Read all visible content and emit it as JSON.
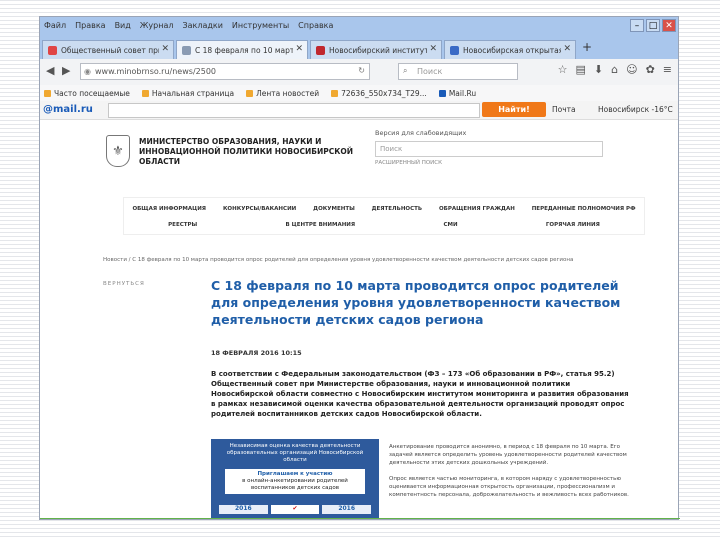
{
  "browser": {
    "menu": [
      "Файл",
      "Правка",
      "Вид",
      "Журнал",
      "Закладки",
      "Инструменты",
      "Справка"
    ],
    "tabs": [
      {
        "label": "Общественный совет при ...",
        "color": "#e04545"
      },
      {
        "label": "С 18 февраля по 10 марта ...",
        "color": "#8a9bb3",
        "active": true
      },
      {
        "label": "Новосибирский институт ...",
        "color": "#c0272d"
      },
      {
        "label": "Новосибирская открытая о...",
        "color": "#3a6ac6"
      }
    ],
    "url": "www.minobrnso.ru/news/2500",
    "search_placeholder": "Поиск",
    "bookmarks": [
      "Часто посещаемые",
      "Начальная страница",
      "Лента новостей",
      "72636_550x734_T29...",
      "Mail.Ru"
    ]
  },
  "mailru": {
    "logo_text": "@mail.ru",
    "search_button": "Найти!",
    "mail_link": "Почта",
    "weather": "Новосибирск -16°C"
  },
  "site": {
    "ministry_name": "МИНИСТЕРСТВО ОБРАЗОВАНИЯ, НАУКИ И ИННОВАЦИОННОЙ ПОЛИТИКИ НОВОСИБИРСКОЙ ОБЛАСТИ",
    "vision_label": "Версия для слабовидящих",
    "search_placeholder": "Поиск",
    "advanced_search": "РАСШИРЕННЫЙ ПОИСК",
    "nav_row1": [
      "ОБЩАЯ ИНФОРМАЦИЯ",
      "КОНКУРСЫ/ВАКАНСИИ",
      "ДОКУМЕНТЫ",
      "ДЕЯТЕЛЬНОСТЬ",
      "ОБРАЩЕНИЯ ГРАЖДАН",
      "ПЕРЕДАННЫЕ ПОЛНОМОЧИЯ РФ"
    ],
    "nav_row2": [
      "РЕЕСТРЫ",
      "В ЦЕНТРЕ ВНИМАНИЯ",
      "СМИ",
      "ГОРЯЧАЯ ЛИНИЯ"
    ],
    "breadcrumb": "Новости  /  С 18 февраля по 10 марта проводится опрос родителей для определения уровня удовлетворенности качеством деятельности детских садов региона",
    "back_link": "ВЕРНУТЬСЯ"
  },
  "article": {
    "title": "С 18 февраля по 10 марта проводится опрос родителей для определения уровня удовлетворенности качеством деятельности детских садов региона",
    "date": "18 ФЕВРАЛЯ 2016 10:15",
    "lead": "В соответствии с Федеральным законодательством (ФЗ – 173 «Об образовании в РФ», статья 95.2) Общественный совет при Министерстве образования, науки и инновационной политики Новосибирской области совместно с Новосибирским институтом мониторинга и развития образования в рамках независимой оценки качества образовательной деятельности организаций проводят опрос родителей воспитанников детских садов Новосибирской области.",
    "poster": {
      "heading": "Независимая оценка качества деятельности образовательных организаций Новосибирской области",
      "invite_title": "Приглашаем к участию",
      "invite_body": "в онлайн-анкетировании родителей воспитанников детских садов",
      "years": [
        "2016",
        "2016"
      ],
      "from": "с 18",
      "to": "до 10"
    },
    "note_p1": "Анкетирование проводится анонимно, в период с 18 февраля по 10 марта. Его задачей является определить уровень удовлетворенности родителей качеством деятельности этих детских дошкольных учреждений.",
    "note_p2": "Опрос является частью мониторинга, в котором наряду с удовлетворенностью оценивается информационная открытость организации, профессионализм и компетентность персонала, доброжелательность и вежливость всех работников."
  }
}
